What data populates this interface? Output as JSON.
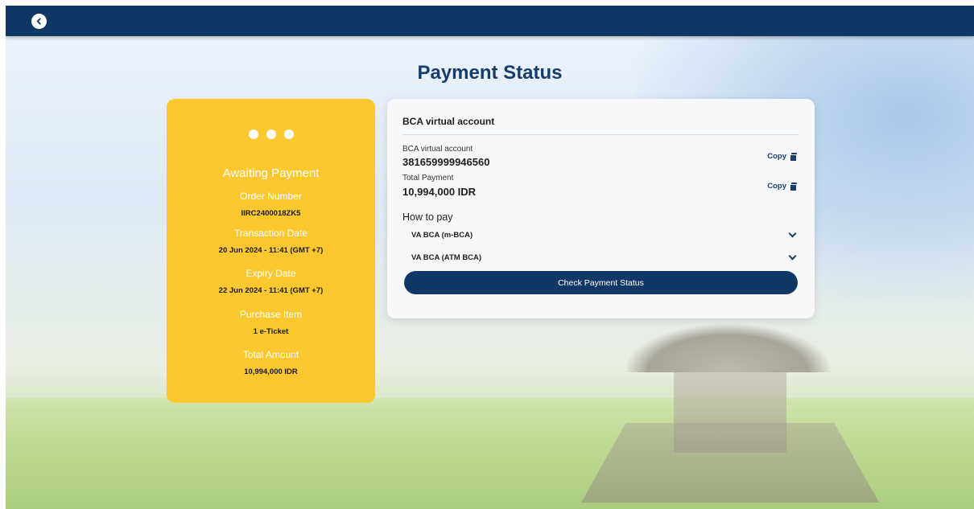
{
  "header": {
    "back_label": "Back"
  },
  "page": {
    "title": "Payment Status"
  },
  "status_card": {
    "heading": "Awaiting Payment",
    "order_number_label": "Order Number",
    "order_number": "IIRC2400018ZK5",
    "transaction_date_label": "Transaction Date",
    "transaction_date": "20 Jun 2024 - 11:41 (GMT +7)",
    "expiry_date_label": "Expiry Date",
    "expiry_date": "22 Jun 2024 - 11:41 (GMT +7)",
    "purchase_item_label": "Purchase Item",
    "purchase_item": "1 e-Ticket",
    "total_amount_label": "Total Amount",
    "total_amount": "10,994,000 IDR"
  },
  "payment_card": {
    "title": "BCA virtual account",
    "va_label": "BCA virtual account",
    "va_number": "381659999946560",
    "total_label": "Total Payment",
    "total_value": "10,994,000 IDR",
    "copy_label": "Copy",
    "how_to_pay": "How to pay",
    "methods": [
      {
        "label": "VA BCA (m-BCA)"
      },
      {
        "label": "VA BCA (ATM BCA)"
      }
    ],
    "check_button": "Check Payment Status"
  },
  "colors": {
    "header_bg": "#113864",
    "status_card_bg": "#fdc82f",
    "primary": "#173d6a"
  }
}
